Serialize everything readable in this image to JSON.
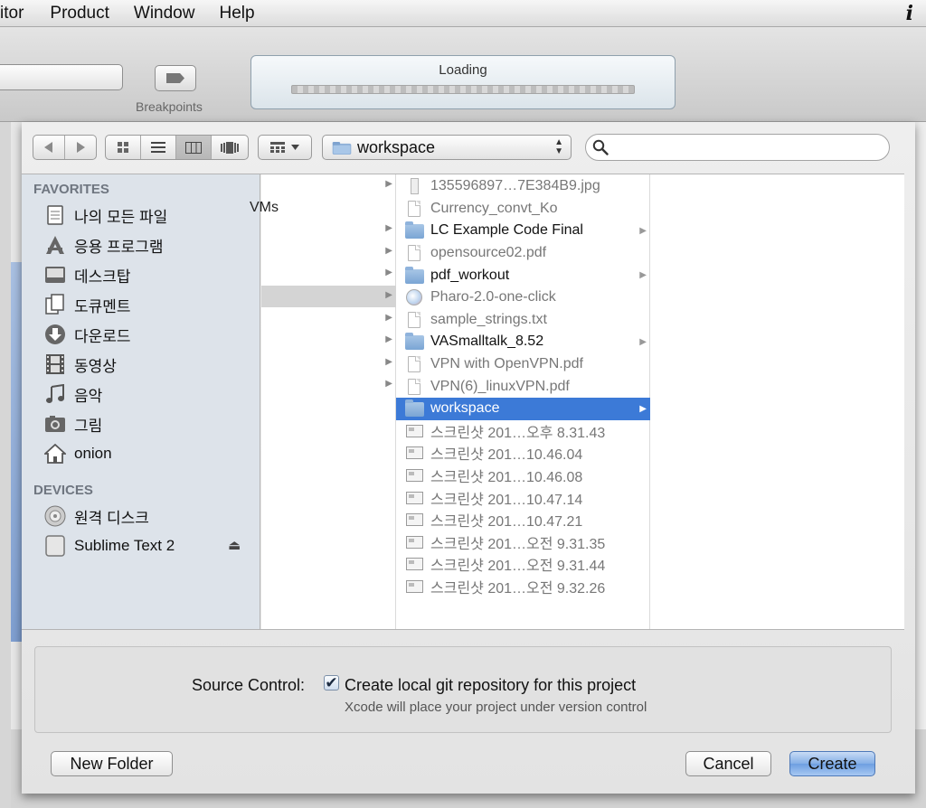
{
  "menubar": {
    "items": [
      "itor",
      "Product",
      "Window",
      "Help"
    ],
    "info_icon": "i"
  },
  "toolbar": {
    "breakpoints_label": "Breakpoints",
    "activity_title": "Loading"
  },
  "sheet": {
    "location": "workspace",
    "search_placeholder": "",
    "sidebar": {
      "favorites_heading": "FAVORITES",
      "favorites": [
        {
          "label": "나의 모든 파일",
          "icon": "all-files-icon"
        },
        {
          "label": "응용 프로그램",
          "icon": "applications-icon"
        },
        {
          "label": "데스크탑",
          "icon": "desktop-icon"
        },
        {
          "label": "도큐멘트",
          "icon": "documents-icon"
        },
        {
          "label": "다운로드",
          "icon": "downloads-icon"
        },
        {
          "label": "동영상",
          "icon": "movies-icon"
        },
        {
          "label": "음악",
          "icon": "music-icon"
        },
        {
          "label": "그림",
          "icon": "pictures-icon"
        },
        {
          "label": "onion",
          "icon": "home-icon"
        }
      ],
      "devices_heading": "DEVICES",
      "devices": [
        {
          "label": "원격 디스크",
          "icon": "remote-disc-icon"
        },
        {
          "label": "Sublime Text 2",
          "icon": "drive-icon"
        }
      ]
    },
    "column1": {
      "rows": [
        "VMs",
        "",
        "",
        "",
        "",
        "",
        "",
        "",
        "",
        ""
      ]
    },
    "column2": {
      "rows": [
        {
          "label": "135596897…7E384B9.jpg",
          "kind": "jpg"
        },
        {
          "label": "Currency_convt_Ko",
          "kind": "doc"
        },
        {
          "label": "LC Example Code Final",
          "kind": "folder"
        },
        {
          "label": "opensource02.pdf",
          "kind": "doc"
        },
        {
          "label": "pdf_workout",
          "kind": "folder"
        },
        {
          "label": "Pharo-2.0-one-click",
          "kind": "app"
        },
        {
          "label": "sample_strings.txt",
          "kind": "doc"
        },
        {
          "label": "VASmalltalk_8.52",
          "kind": "folder"
        },
        {
          "label": "VPN with OpenVPN.pdf",
          "kind": "doc"
        },
        {
          "label": "VPN(6)_linuxVPN.pdf",
          "kind": "doc"
        },
        {
          "label": "workspace",
          "kind": "folder",
          "selected": true
        },
        {
          "label": "스크린샷 201…오후 8.31.43",
          "kind": "shot"
        },
        {
          "label": "스크린샷 201…10.46.04",
          "kind": "shot"
        },
        {
          "label": "스크린샷 201…10.46.08",
          "kind": "shot"
        },
        {
          "label": "스크린샷 201…10.47.14",
          "kind": "shot"
        },
        {
          "label": "스크린샷 201…10.47.21",
          "kind": "shot"
        },
        {
          "label": "스크린샷 201…오전 9.31.35",
          "kind": "shot"
        },
        {
          "label": "스크린샷 201…오전 9.31.44",
          "kind": "shot"
        },
        {
          "label": "스크린샷 201…오전 9.32.26",
          "kind": "shot"
        }
      ]
    },
    "options": {
      "source_control_label": "Source Control:",
      "checkbox_checked": true,
      "checkbox_label": "Create local git repository for this project",
      "hint": "Xcode will place your project under version control"
    },
    "buttons": {
      "new_folder": "New Folder",
      "cancel": "Cancel",
      "create": "Create"
    }
  }
}
